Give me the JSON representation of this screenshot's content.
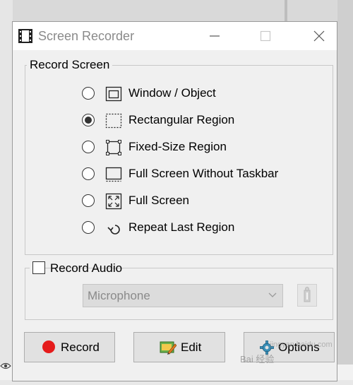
{
  "window": {
    "title": "Screen Recorder",
    "app_icon": "film-strip-icon",
    "controls": [
      "minimize-icon",
      "maximize-icon",
      "close-icon"
    ]
  },
  "record_screen": {
    "legend": "Record Screen",
    "options": [
      {
        "label": "Window / Object",
        "icon": "window-object-icon",
        "selected": false
      },
      {
        "label": "Rectangular Region",
        "icon": "rectangular-region-icon",
        "selected": true
      },
      {
        "label": "Fixed-Size Region",
        "icon": "fixed-size-region-icon",
        "selected": false
      },
      {
        "label": "Full Screen Without Taskbar",
        "icon": "full-screen-without-taskbar-icon",
        "selected": false
      },
      {
        "label": "Full Screen",
        "icon": "full-screen-icon",
        "selected": false
      },
      {
        "label": "Repeat Last Region",
        "icon": "repeat-last-region-icon",
        "selected": false
      }
    ]
  },
  "record_audio": {
    "label": "Record Audio",
    "checked": false,
    "device": "Microphone"
  },
  "buttons": {
    "record": "Record",
    "edit": "Edit",
    "options": "Options"
  },
  "watermark": {
    "text": "Bai 经验",
    "sub": "jingyan.baidu.com"
  },
  "colors": {
    "record_dot": "#e51b1b",
    "window_bg": "#f0f0f0",
    "disabled_text": "#8a8a8a"
  }
}
